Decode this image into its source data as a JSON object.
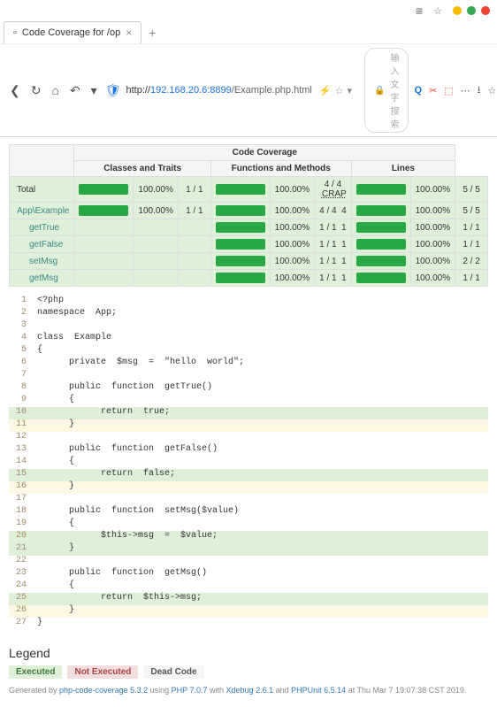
{
  "browser": {
    "tab_title": "Code Coverage for /op",
    "url_host": "192.168.20.6:8899",
    "url_path": "/Example.php.html",
    "url_prefix": "http://",
    "search_placeholder": "输入文字搜索"
  },
  "table": {
    "super_header": "Code Coverage",
    "headers": {
      "classes": "Classes and Traits",
      "functions": "Functions and Methods",
      "lines": "Lines"
    },
    "crap_label": "CRAP",
    "rows": [
      {
        "name": "Total",
        "cls_pct": "100.00%",
        "cls_frac": "1 / 1",
        "fn_pct": "100.00%",
        "fn_frac": "4 / 4",
        "crap": "CRAP",
        "ln_pct": "100.00%",
        "ln_frac": "5 / 5",
        "type": "total"
      },
      {
        "name": "App\\Example",
        "cls_pct": "100.00%",
        "cls_frac": "1 / 1",
        "fn_pct": "100.00%",
        "fn_frac": "4 / 4",
        "crap": "4",
        "ln_pct": "100.00%",
        "ln_frac": "5 / 5",
        "type": "class"
      },
      {
        "name": "getTrue",
        "cls_pct": "",
        "cls_frac": "",
        "fn_pct": "100.00%",
        "fn_frac": "1 / 1",
        "crap": "1",
        "ln_pct": "100.00%",
        "ln_frac": "1 / 1",
        "type": "method"
      },
      {
        "name": "getFalse",
        "cls_pct": "",
        "cls_frac": "",
        "fn_pct": "100.00%",
        "fn_frac": "1 / 1",
        "crap": "1",
        "ln_pct": "100.00%",
        "ln_frac": "1 / 1",
        "type": "method"
      },
      {
        "name": "setMsg",
        "cls_pct": "",
        "cls_frac": "",
        "fn_pct": "100.00%",
        "fn_frac": "1 / 1",
        "crap": "1",
        "ln_pct": "100.00%",
        "ln_frac": "2 / 2",
        "type": "method"
      },
      {
        "name": "getMsg",
        "cls_pct": "",
        "cls_frac": "",
        "fn_pct": "100.00%",
        "fn_frac": "1 / 1",
        "crap": "1",
        "ln_pct": "100.00%",
        "ln_frac": "1 / 1",
        "type": "method"
      }
    ]
  },
  "code": {
    "lines": [
      {
        "n": "1",
        "t": "<?php",
        "hl": ""
      },
      {
        "n": "2",
        "t": "namespace  App;",
        "hl": ""
      },
      {
        "n": "3",
        "t": "",
        "hl": ""
      },
      {
        "n": "4",
        "t": "class  Example",
        "hl": ""
      },
      {
        "n": "5",
        "t": "{",
        "hl": ""
      },
      {
        "n": "6",
        "t": "      private  $msg  =  \"hello  world\";",
        "hl": ""
      },
      {
        "n": "7",
        "t": "",
        "hl": ""
      },
      {
        "n": "8",
        "t": "      public  function  getTrue()",
        "hl": ""
      },
      {
        "n": "9",
        "t": "      {",
        "hl": ""
      },
      {
        "n": "10",
        "t": "            return  true;",
        "hl": "g"
      },
      {
        "n": "11",
        "t": "      }",
        "hl": "y"
      },
      {
        "n": "12",
        "t": "",
        "hl": ""
      },
      {
        "n": "13",
        "t": "      public  function  getFalse()",
        "hl": ""
      },
      {
        "n": "14",
        "t": "      {",
        "hl": ""
      },
      {
        "n": "15",
        "t": "            return  false;",
        "hl": "g"
      },
      {
        "n": "16",
        "t": "      }",
        "hl": "y"
      },
      {
        "n": "17",
        "t": "",
        "hl": ""
      },
      {
        "n": "18",
        "t": "      public  function  setMsg($value)",
        "hl": ""
      },
      {
        "n": "19",
        "t": "      {",
        "hl": ""
      },
      {
        "n": "20",
        "t": "            $this->msg  =  $value;",
        "hl": "g"
      },
      {
        "n": "21",
        "t": "      }",
        "hl": "g"
      },
      {
        "n": "22",
        "t": "",
        "hl": ""
      },
      {
        "n": "23",
        "t": "      public  function  getMsg()",
        "hl": ""
      },
      {
        "n": "24",
        "t": "      {",
        "hl": ""
      },
      {
        "n": "25",
        "t": "            return  $this->msg;",
        "hl": "g"
      },
      {
        "n": "26",
        "t": "      }",
        "hl": "y"
      },
      {
        "n": "27",
        "t": "}",
        "hl": ""
      }
    ]
  },
  "legend": {
    "title": "Legend",
    "executed": "Executed",
    "not_executed": "Not Executed",
    "dead": "Dead Code"
  },
  "footer": {
    "text_1": "Generated by ",
    "link_1": "php-code-coverage 5.3.2",
    "text_2": " using ",
    "link_2": "PHP 7.0.7",
    "text_3": " with ",
    "link_3": "Xdebug 2.6.1",
    "text_4": " and ",
    "link_4": "PHPUnit 6.5.14",
    "text_5": " at Thu Mar 7 19:07:38 CST 2019."
  }
}
